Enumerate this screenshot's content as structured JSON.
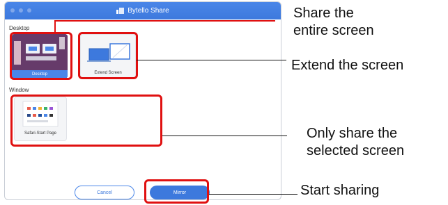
{
  "window": {
    "title": "Bytello Share"
  },
  "sections": {
    "desktop": "Desktop",
    "window": "Window"
  },
  "items": {
    "desktop": {
      "caption": "Desktop"
    },
    "extend": {
      "caption": "Extend Screen"
    },
    "safari": {
      "caption": "Safari-Start Page"
    }
  },
  "buttons": {
    "cancel": "Cancel",
    "mirror": "Mirror"
  },
  "annotations": {
    "share_entire": [
      "Share the",
      "entire screen"
    ],
    "extend": "Extend the screen",
    "only_share": [
      "Only share the",
      "selected screen"
    ],
    "start": "Start sharing"
  },
  "colors": {
    "accent": "#3d79dd",
    "highlight": "#e01010"
  }
}
